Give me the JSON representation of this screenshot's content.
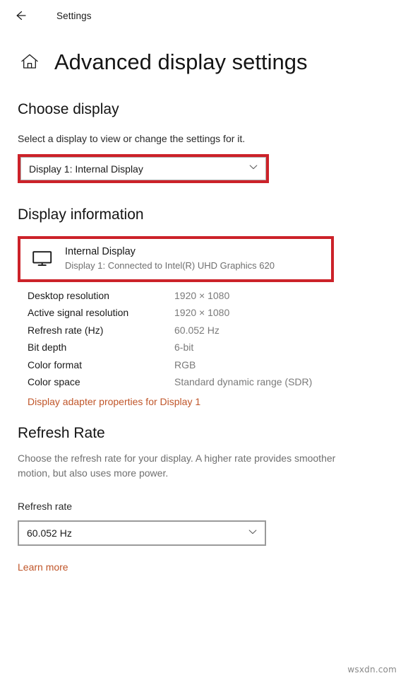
{
  "titlebar": {
    "back_icon": "back-arrow-icon",
    "label": "Settings"
  },
  "header": {
    "home_icon": "home-icon",
    "title": "Advanced display settings"
  },
  "choose_display": {
    "heading": "Choose display",
    "description": "Select a display to view or change the settings for it.",
    "select_value": "Display 1: Internal Display",
    "chevron_icon": "chevron-down-icon",
    "annotation_color": "#cc2229"
  },
  "display_information": {
    "heading": "Display information",
    "panel": {
      "monitor_icon": "monitor-icon",
      "name": "Internal Display",
      "subtitle": "Display 1: Connected to Intel(R) UHD Graphics 620"
    },
    "rows": [
      {
        "label": "Desktop resolution",
        "value": "1920 × 1080"
      },
      {
        "label": "Active signal resolution",
        "value": "1920 × 1080"
      },
      {
        "label": "Refresh rate (Hz)",
        "value": "60.052 Hz"
      },
      {
        "label": "Bit depth",
        "value": "6-bit"
      },
      {
        "label": "Color format",
        "value": "RGB"
      },
      {
        "label": "Color space",
        "value": "Standard dynamic range (SDR)"
      }
    ],
    "adapter_link": "Display adapter properties for Display 1",
    "link_color": "#c0562a"
  },
  "refresh_rate": {
    "heading": "Refresh Rate",
    "description": "Choose the refresh rate for your display. A higher rate provides smoother motion, but also uses more power.",
    "field_label": "Refresh rate",
    "select_value": "60.052 Hz",
    "chevron_icon": "chevron-down-icon",
    "learn_more": "Learn more"
  },
  "watermark": "wsxdn.com"
}
